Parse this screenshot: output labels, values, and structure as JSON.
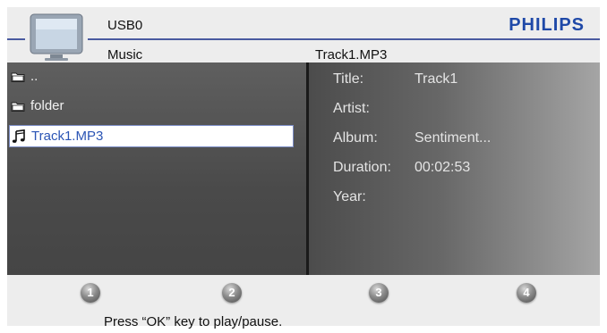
{
  "header": {
    "source": "USB0",
    "brand": "PHILIPS",
    "breadcrumb": "Music",
    "current_file": "Track1.MP3",
    "accent_color": "#1f49a8"
  },
  "browser": {
    "items": [
      {
        "label": "..",
        "icon": "folder-icon"
      },
      {
        "label": "folder",
        "icon": "folder-icon"
      },
      {
        "label": "Track1.MP3",
        "icon": "music-note-icon",
        "selected": true
      }
    ]
  },
  "info": {
    "title_label": "Title:",
    "title_value": "Track1",
    "artist_label": "Artist:",
    "artist_value": "",
    "album_label": "Album:",
    "album_value": "Sentiment...",
    "duration_label": "Duration:",
    "duration_value": "00:02:53",
    "year_label": "Year:",
    "year_value": ""
  },
  "footer": {
    "buttons": [
      "1",
      "2",
      "3",
      "4"
    ],
    "hint": "Press “OK” key to play/pause."
  }
}
